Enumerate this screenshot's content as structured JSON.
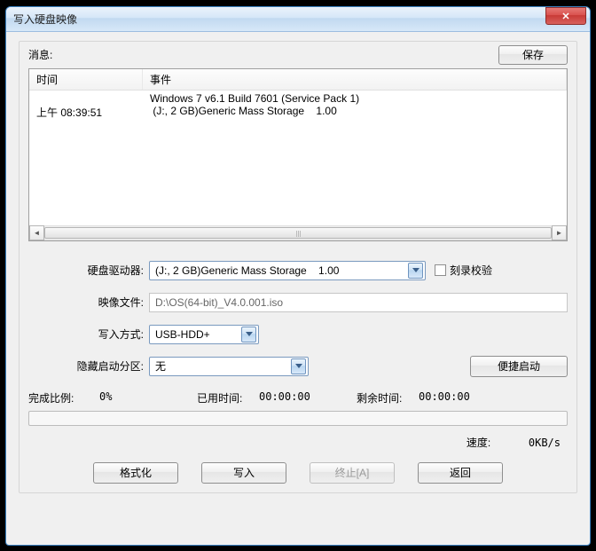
{
  "window": {
    "title": "写入硬盘映像"
  },
  "header": {
    "message_label": "消息:",
    "save_label": "保存"
  },
  "log": {
    "columns": {
      "time": "时间",
      "event": "事件"
    },
    "rows": [
      {
        "time": "",
        "event": "Windows 7 v6.1 Build 7601 (Service Pack 1)"
      },
      {
        "time": "上午 08:39:51",
        "event": " (J:, 2 GB)Generic Mass Storage    1.00"
      }
    ]
  },
  "form": {
    "drive_label": "硬盘驱动器:",
    "drive_value": "(J:, 2 GB)Generic Mass Storage    1.00",
    "verify_label": "刻录校验",
    "image_label": "映像文件:",
    "image_value": "D:\\OS(64-bit)_V4.0.001.iso",
    "write_mode_label": "写入方式:",
    "write_mode_value": "USB-HDD+",
    "hidden_boot_label": "隐藏启动分区:",
    "hidden_boot_value": "无",
    "quick_boot_label": "便捷启动"
  },
  "status": {
    "progress_label": "完成比例:",
    "progress_value": "0%",
    "elapsed_label": "已用时间:",
    "elapsed_value": "00:00:00",
    "remaining_label": "剩余时间:",
    "remaining_value": "00:00:00",
    "speed_label": "速度:",
    "speed_value": "0KB/s"
  },
  "buttons": {
    "format": "格式化",
    "write": "写入",
    "abort": "终止[A]",
    "back": "返回"
  }
}
